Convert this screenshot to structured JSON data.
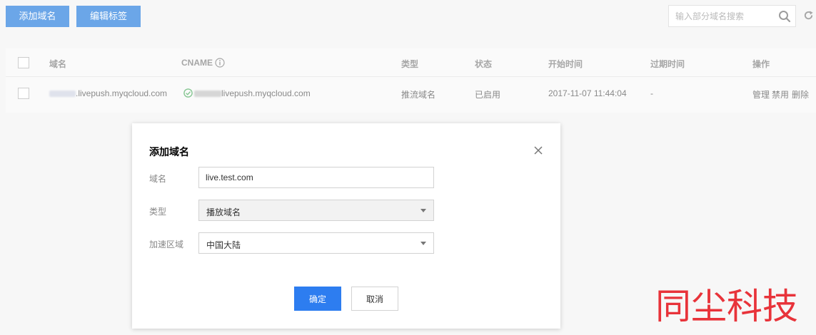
{
  "toolbar": {
    "add_domain_label": "添加域名",
    "edit_tags_label": "编辑标签",
    "search_placeholder": "输入部分域名搜索"
  },
  "table": {
    "headers": {
      "domain": "域名",
      "cname": "CNAME",
      "type": "类型",
      "status": "状态",
      "start_time": "开始时间",
      "expire_time": "过期时间",
      "actions": "操作"
    },
    "rows": [
      {
        "domain": ".livepush.myqcloud.com",
        "cname": "livepush.myqcloud.com",
        "type": "推流域名",
        "status": "已启用",
        "start_time": "2017-11-07 11:44:04",
        "expire_time": "-",
        "action_manage": "管理",
        "action_disable": "禁用",
        "action_delete": "删除"
      }
    ]
  },
  "dialog": {
    "title": "添加域名",
    "domain_label": "域名",
    "domain_value": "live.test.com",
    "type_label": "类型",
    "type_value": "播放域名",
    "region_label": "加速区域",
    "region_value": "中国大陆",
    "confirm_label": "确定",
    "cancel_label": "取消"
  },
  "watermark": "同尘科技",
  "colors": {
    "primary": "#0067d8",
    "confirm": "#2d7df0",
    "status_ok": "#2f9e44",
    "watermark": "#e8333a"
  }
}
